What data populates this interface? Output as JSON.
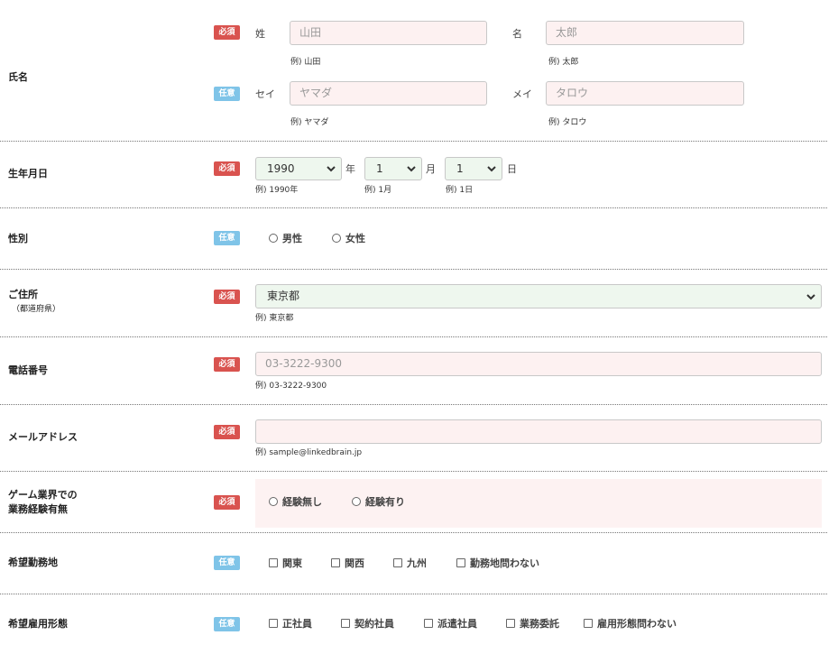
{
  "badges": {
    "required": "必須",
    "optional": "任意"
  },
  "name": {
    "label": "氏名",
    "sei_label": "姓",
    "sei_placeholder": "山田",
    "sei_hint": "例) 山田",
    "mei_label": "名",
    "mei_placeholder": "太郎",
    "mei_hint": "例) 太郎",
    "sei_kana_label": "セイ",
    "sei_kana_placeholder": "ヤマダ",
    "sei_kana_hint": "例) ヤマダ",
    "mei_kana_label": "メイ",
    "mei_kana_placeholder": "タロウ",
    "mei_kana_hint": "例) タロウ"
  },
  "birthday": {
    "label": "生年月日",
    "year_value": "1990",
    "year_unit": "年",
    "year_hint": "例) 1990年",
    "month_value": "1",
    "month_unit": "月",
    "month_hint": "例) 1月",
    "day_value": "1",
    "day_unit": "日",
    "day_hint": "例) 1日"
  },
  "gender": {
    "label": "性別",
    "options": [
      "男性",
      "女性"
    ]
  },
  "address": {
    "label": "ご住所",
    "sublabel": "（都道府県）",
    "value": "東京都",
    "hint": "例) 東京都"
  },
  "phone": {
    "label": "電話番号",
    "placeholder": "03-3222-9300",
    "hint": "例) 03-3222-9300"
  },
  "email": {
    "label": "メールアドレス",
    "placeholder": "",
    "hint": "例) sample@linkedbrain.jp"
  },
  "experience": {
    "label_line1": "ゲーム業界での",
    "label_line2": "業務経験有無",
    "options": [
      "経験無し",
      "経験有り"
    ]
  },
  "location": {
    "label": "希望勤務地",
    "options": [
      "関東",
      "関西",
      "九州",
      "勤務地問わない"
    ]
  },
  "employment": {
    "label": "希望雇用形態",
    "options": [
      "正社員",
      "契約社員",
      "派遣社員",
      "業務委託",
      "雇用形態問わない"
    ]
  },
  "colors": {
    "required": "#d9534f",
    "optional": "#7fc4e8",
    "input_bg": "#fdf1f1",
    "select_bg": "#eef7ee"
  }
}
